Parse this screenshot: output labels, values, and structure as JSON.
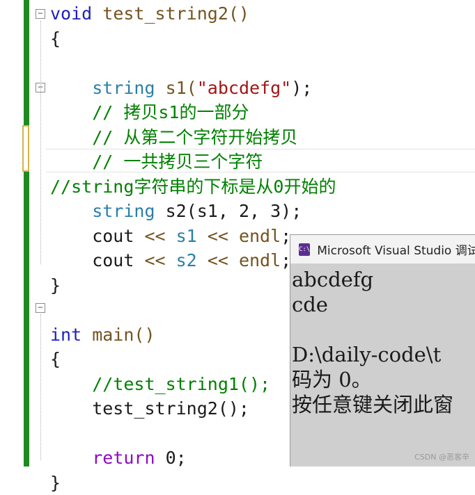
{
  "editor": {
    "lines": [
      {
        "parts": [
          {
            "t": "void",
            "c": "kw"
          },
          {
            "t": " test_string2()",
            "c": "fn"
          }
        ]
      },
      {
        "parts": [
          {
            "t": "{",
            "c": ""
          }
        ]
      },
      {
        "parts": [
          {
            "t": "",
            "c": ""
          }
        ]
      },
      {
        "parts": [
          {
            "t": "    ",
            "c": ""
          },
          {
            "t": "string",
            "c": "ty"
          },
          {
            "t": " s1(",
            "c": "fn"
          },
          {
            "t": "\"abcdefg\"",
            "c": "str"
          },
          {
            "t": ");",
            "c": ""
          }
        ]
      },
      {
        "parts": [
          {
            "t": "    ",
            "c": ""
          },
          {
            "t": "// 拷贝s1的一部分",
            "c": "cm"
          }
        ]
      },
      {
        "parts": [
          {
            "t": "    ",
            "c": ""
          },
          {
            "t": "// 从第二个字符开始拷贝",
            "c": "cm"
          }
        ]
      },
      {
        "parts": [
          {
            "t": "    ",
            "c": ""
          },
          {
            "t": "// 一共拷贝三个字符",
            "c": "cm"
          }
        ]
      },
      {
        "parts": [
          {
            "t": "//string字符串的下标是从0开始的",
            "c": "cm"
          }
        ]
      },
      {
        "parts": [
          {
            "t": "    ",
            "c": ""
          },
          {
            "t": "string",
            "c": "ty"
          },
          {
            "t": " s2(s1, 2, 3);",
            "c": ""
          }
        ]
      },
      {
        "parts": [
          {
            "t": "    cout ",
            "c": ""
          },
          {
            "t": "<<",
            "c": "fn"
          },
          {
            "t": " s1 ",
            "c": "ty"
          },
          {
            "t": "<<",
            "c": "fn"
          },
          {
            "t": " endl",
            "c": "fn"
          },
          {
            "t": ";",
            "c": ""
          }
        ]
      },
      {
        "parts": [
          {
            "t": "    cout ",
            "c": ""
          },
          {
            "t": "<<",
            "c": "fn"
          },
          {
            "t": " s2 ",
            "c": "ty"
          },
          {
            "t": "<<",
            "c": "fn"
          },
          {
            "t": " endl",
            "c": "fn"
          },
          {
            "t": ";",
            "c": ""
          }
        ]
      },
      {
        "parts": [
          {
            "t": "}",
            "c": ""
          }
        ]
      },
      {
        "parts": [
          {
            "t": "",
            "c": ""
          }
        ]
      },
      {
        "parts": [
          {
            "t": "int",
            "c": "kw"
          },
          {
            "t": " main()",
            "c": "fn"
          }
        ]
      },
      {
        "parts": [
          {
            "t": "{",
            "c": ""
          }
        ]
      },
      {
        "parts": [
          {
            "t": "    ",
            "c": ""
          },
          {
            "t": "//test_string1();",
            "c": "cm"
          }
        ]
      },
      {
        "parts": [
          {
            "t": "    test_string2();",
            "c": ""
          }
        ]
      },
      {
        "parts": [
          {
            "t": "",
            "c": ""
          }
        ]
      },
      {
        "parts": [
          {
            "t": "    ",
            "c": ""
          },
          {
            "t": "return",
            "c": "purple"
          },
          {
            "t": " 0;",
            "c": ""
          }
        ]
      },
      {
        "parts": [
          {
            "t": "}",
            "c": ""
          }
        ]
      }
    ]
  },
  "console": {
    "title": "Microsoft Visual Studio 调试",
    "icon": "vs-console-icon",
    "output": [
      "abcdefg",
      "cde",
      "",
      "D:\\daily-code\\t",
      "码为 0。",
      "按任意键关闭此窗"
    ]
  },
  "watermark": "CSDN @恶客辛"
}
